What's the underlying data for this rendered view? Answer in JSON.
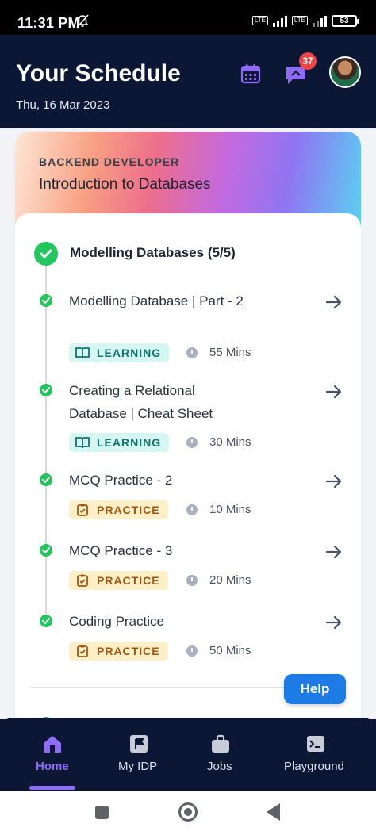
{
  "status_bar": {
    "time": "11:31 PM",
    "battery": "53"
  },
  "header": {
    "title": "Your Schedule",
    "date": "Thu, 16 Mar 2023",
    "notification_count": "37",
    "icons": [
      "calendar-icon",
      "chat-icon",
      "avatar"
    ]
  },
  "course": {
    "track": "BACKEND DEVELOPER",
    "name": "Introduction to Databases",
    "module": {
      "title": "Modelling Databases (5/5)",
      "items": [
        {
          "title": "Modelling Database | Part - 2",
          "type": "LEARNING",
          "duration": "55 Mins"
        },
        {
          "title": "Creating a Relational Database | Cheat Sheet",
          "type": "LEARNING",
          "duration": "30 Mins"
        },
        {
          "title": "MCQ Practice - 2",
          "type": "PRACTICE",
          "duration": "10 Mins"
        },
        {
          "title": "MCQ Practice - 3",
          "type": "PRACTICE",
          "duration": "20 Mins"
        },
        {
          "title": "Coding Practice",
          "type": "PRACTICE",
          "duration": "50 Mins"
        }
      ]
    }
  },
  "help": {
    "label": "Help"
  },
  "bottom_nav": {
    "items": [
      {
        "label": "Home",
        "icon": "home-icon",
        "active": true
      },
      {
        "label": "My IDP",
        "icon": "flag-icon",
        "active": false
      },
      {
        "label": "Jobs",
        "icon": "briefcase-icon",
        "active": false
      },
      {
        "label": "Playground",
        "icon": "terminal-icon",
        "active": false
      }
    ]
  },
  "colors": {
    "header_bg": "#0b1735",
    "accent": "#8f6cf5",
    "success": "#22c55e",
    "learning_bg": "#d6f6f4",
    "practice_bg": "#fdf0c8",
    "help_button": "#1d7be6"
  }
}
